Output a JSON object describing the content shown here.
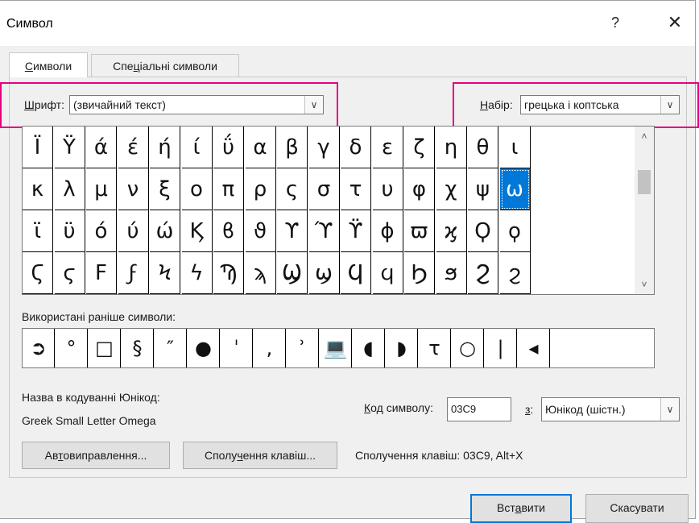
{
  "window": {
    "title": "Символ",
    "help_label": "?",
    "close_label": "✕"
  },
  "tabs": [
    {
      "prefix": "",
      "accel": "С",
      "rest": "имволи",
      "active": true
    },
    {
      "prefix": "Спе",
      "accel": "ц",
      "rest": "іальні символи",
      "active": false
    }
  ],
  "font": {
    "label_accel": "Ш",
    "label_rest": "рифт:",
    "value": "(звичайний текст)"
  },
  "subset": {
    "label_accel": "Н",
    "label_rest": "абір:",
    "value": "грецька і коптська"
  },
  "symbol_grid": {
    "rows": [
      [
        "Ϊ",
        "Ϋ",
        "ά",
        "έ",
        "ή",
        "ί",
        "ΰ",
        "α",
        "β",
        "γ",
        "δ",
        "ε",
        "ζ",
        "η",
        "θ",
        "ι"
      ],
      [
        "κ",
        "λ",
        "μ",
        "ν",
        "ξ",
        "ο",
        "π",
        "ρ",
        "ς",
        "σ",
        "τ",
        "υ",
        "φ",
        "χ",
        "ψ",
        "ω"
      ],
      [
        "ϊ",
        "ϋ",
        "ό",
        "ύ",
        "ώ",
        "Ϗ",
        "ϐ",
        "ϑ",
        "ϒ",
        "ϓ",
        "ϔ",
        "ϕ",
        "ϖ",
        "ϗ",
        "Ϙ",
        "ϙ"
      ],
      [
        "Ϛ",
        "ϛ",
        "Ϝ",
        "ϝ",
        "Ϟ",
        "ϟ",
        "Ϡ",
        "ϡ",
        "Ϣ",
        "ϣ",
        "Ϥ",
        "ϥ",
        "Ϧ",
        "ϧ",
        "Ϩ",
        "ϩ"
      ]
    ],
    "selected_row": 1,
    "selected_col": 15,
    "scroll_up": "˄",
    "scroll_down": "˅"
  },
  "recent": {
    "label": "Використані раніше символи:",
    "symbols": [
      "➲",
      "°",
      "□",
      "§",
      "″",
      "●",
      "ˈ",
      ",",
      "ʾ",
      "💻",
      "◖",
      "◗",
      "τ",
      "○",
      "|",
      "◂"
    ]
  },
  "unicode_name": {
    "label": "Назва в кодуванні Юнікод:",
    "value": "Greek Small Letter Omega"
  },
  "char_code": {
    "label_accel": "К",
    "label_rest": "од символу:",
    "value": "03C9"
  },
  "from": {
    "label_accel": "з",
    "label_rest": ":",
    "value": "Юнікод (шістн.)"
  },
  "buttons": {
    "autocorrect_prefix": "Ав",
    "autocorrect_accel": "т",
    "autocorrect_rest": "овиправлення...",
    "shortcut_prefix": "Сполу",
    "shortcut_accel": "ч",
    "shortcut_rest": "ення клавіш...",
    "insert_prefix": "Вст",
    "insert_accel": "а",
    "insert_rest": "вити",
    "cancel": "Скасувати"
  },
  "shortcut_info": "Сполучення клавіш: 03C9, Alt+X",
  "colors": {
    "highlight": "#e6007e",
    "selection": "#0078d7"
  }
}
